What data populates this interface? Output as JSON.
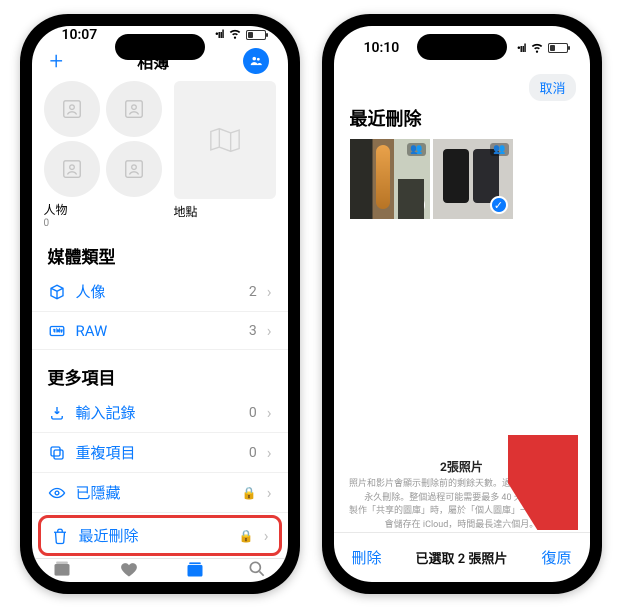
{
  "left": {
    "status_time": "10:07",
    "nav_title": "相簿",
    "people_label": "人物",
    "people_count": "0",
    "places_label": "地點",
    "section_media": "媒體類型",
    "media_rows": [
      {
        "label": "人像",
        "count": "2"
      },
      {
        "label": "RAW",
        "count": "3"
      }
    ],
    "section_more": "更多項目",
    "more_rows": [
      {
        "label": "輸入記錄",
        "count": "0"
      },
      {
        "label": "重複項目",
        "count": "0"
      },
      {
        "label": "已隱藏",
        "locked": true
      },
      {
        "label": "最近刪除",
        "locked": true,
        "highlight": true
      }
    ],
    "tabs": [
      {
        "label": "圖庫"
      },
      {
        "label": "為你推薦"
      },
      {
        "label": "相簿",
        "active": true
      },
      {
        "label": "搜尋"
      }
    ]
  },
  "right": {
    "status_time": "10:10",
    "cancel": "取消",
    "title": "最近刪除",
    "info_head": "2張照片",
    "info_line1": "照片和影片會顯示刪除前的剩餘天數。過了那天，項目會永久刪除。整個過程可能需要最多 40 天的時間。",
    "info_line2": "製作「共享的圖庫」時，屬於「個人圖庫」一部分的項目會儲存在 iCloud，時間最長達六個月。",
    "delete": "刪除",
    "selected": "已選取 2 張照片",
    "restore": "復原"
  }
}
